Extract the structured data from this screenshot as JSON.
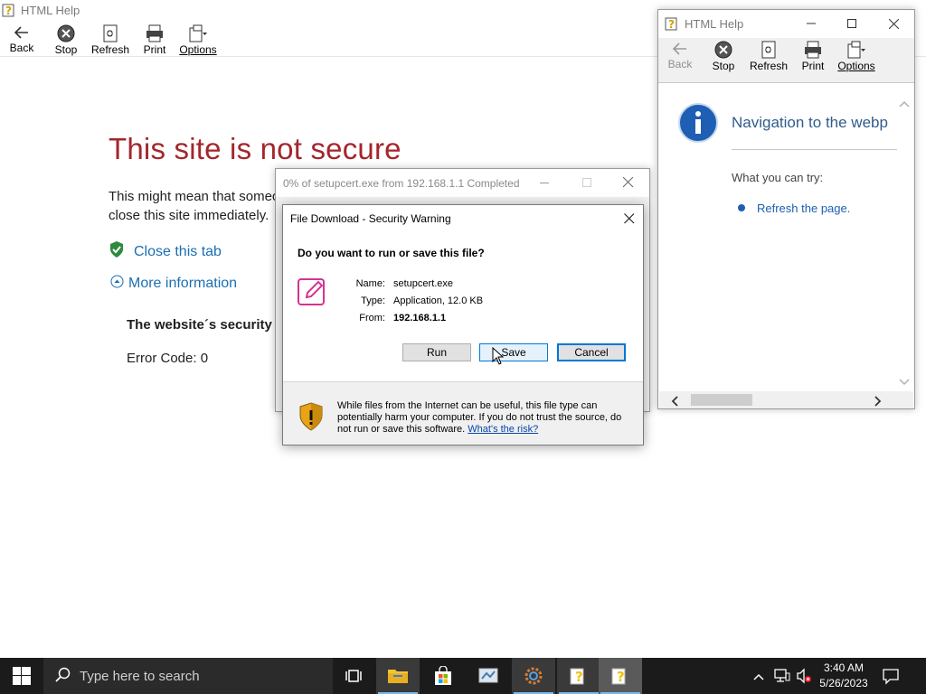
{
  "bg_window": {
    "title": "HTML Help",
    "toolbar": [
      {
        "label": "Back",
        "icon": "back-arrow-icon"
      },
      {
        "label": "Stop",
        "icon": "stop-icon"
      },
      {
        "label": "Refresh",
        "icon": "refresh-icon"
      },
      {
        "label": "Print",
        "icon": "printer-icon"
      },
      {
        "label": "Options",
        "icon": "options-icon"
      }
    ],
    "error_title": "This site is not secure",
    "error_text_1": "This might mean that someo",
    "error_text_2": "close this site immediately.",
    "close_tab": "Close this tab",
    "more_info": "More information",
    "security_heading": "The website´s security",
    "error_code": "Error Code: 0"
  },
  "help_window": {
    "title": "HTML Help",
    "toolbar": [
      {
        "label": "Back",
        "icon": "back-arrow-icon",
        "disabled": true
      },
      {
        "label": "Stop",
        "icon": "stop-icon"
      },
      {
        "label": "Refresh",
        "icon": "refresh-icon"
      },
      {
        "label": "Print",
        "icon": "printer-icon"
      },
      {
        "label": "Options",
        "icon": "options-icon"
      }
    ],
    "heading": "Navigation to the webp",
    "what_you_can_try": "What you can try:",
    "refresh_link": "Refresh the page."
  },
  "progress_window": {
    "title": "0% of setupcert.exe from 192.168.1.1 Completed"
  },
  "download_dialog": {
    "title": "File Download - Security Warning",
    "question": "Do you want to run or save this file?",
    "name_label": "Name:",
    "name_value": "setupcert.exe",
    "type_label": "Type:",
    "type_value": "Application, 12.0 KB",
    "from_label": "From:",
    "from_value": "192.168.1.1",
    "run_label": "Run",
    "save_label": "Save",
    "cancel_label": "Cancel",
    "warning_text": "While files from the Internet can be useful, this file type can potentially harm your computer. If you do not trust the source, do not run or save this software.",
    "risk_link": "What's the risk?"
  },
  "taskbar": {
    "search_placeholder": "Type here to search",
    "time": "3:40 AM",
    "date": "5/26/2023"
  },
  "colors": {
    "error_red": "#a4262c",
    "link_blue": "#1a6fb3",
    "taskbar": "#1b1b1b",
    "accent": "#0078d7"
  }
}
